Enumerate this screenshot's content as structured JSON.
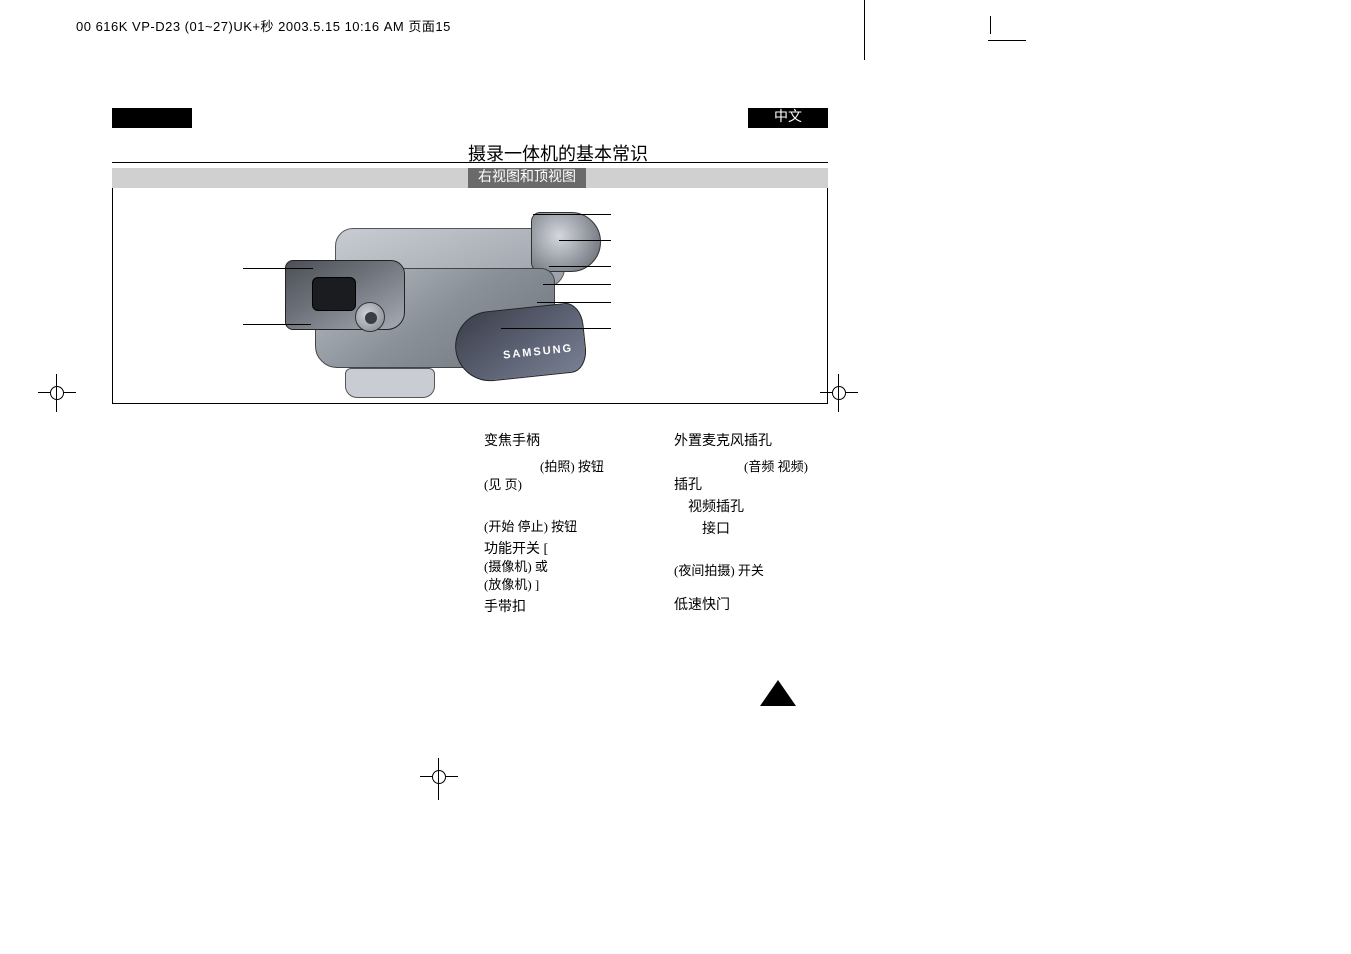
{
  "header": {
    "filenote": "00 616K VP-D23 (01~27)UK+",
    "filenote_cjk": "秒",
    "timestamp": " 2003.5.15 10:16 AM ",
    "pagelabel_cjk": "页面",
    "pagelabel_num": "15"
  },
  "lang_label": "中文",
  "page_title": "摄录一体机的基本常识",
  "subtitle": "右视图和顶视图",
  "logo": "SAMSUNG",
  "labels_left": {
    "l1": "变焦手柄",
    "l2a": "(拍照) 按钮",
    "l2b": "(见   页)",
    "l3": "(开始 停止) 按钮",
    "l4a": "功能开关 [",
    "l4b": "(摄像机) 或",
    "l4c": "(放像机) ]",
    "l5": "手带扣"
  },
  "labels_right": {
    "r1": "外置麦克风插孔",
    "r2a": "(音频 视频)",
    "r2b": "插孔",
    "r3": "视频插孔",
    "r4": "接口",
    "r5": "(夜间拍摄) 开关",
    "r6": "低速快门"
  }
}
